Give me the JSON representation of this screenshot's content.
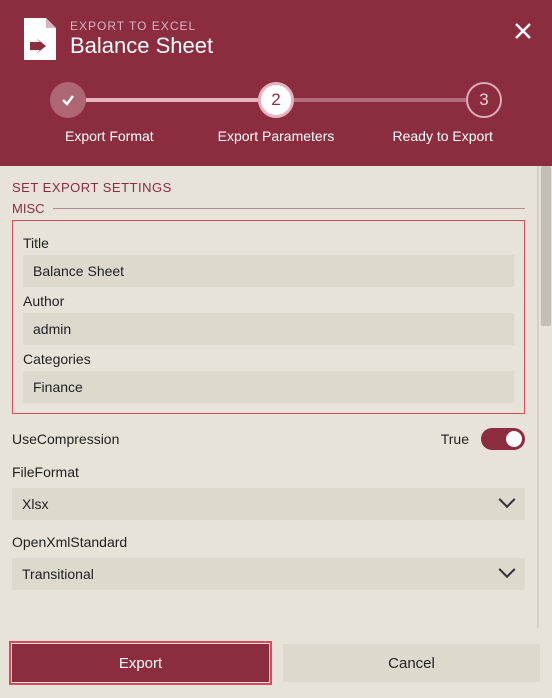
{
  "header": {
    "subtitle": "EXPORT TO EXCEL",
    "title": "Balance Sheet"
  },
  "steps": {
    "items": [
      {
        "index": 1,
        "label": "Export Format",
        "state": "done"
      },
      {
        "index": 2,
        "label": "Export Parameters",
        "state": "current"
      },
      {
        "index": 3,
        "label": "Ready to Export",
        "state": "future"
      }
    ]
  },
  "section": {
    "heading": "SET EXPORT SETTINGS",
    "group": "MISC",
    "fields": {
      "title": {
        "label": "Title",
        "value": "Balance Sheet"
      },
      "author": {
        "label": "Author",
        "value": "admin"
      },
      "categories": {
        "label": "Categories",
        "value": "Finance"
      },
      "useCompression": {
        "label": "UseCompression",
        "valueText": "True",
        "value": true
      },
      "fileFormat": {
        "label": "FileFormat",
        "value": "Xlsx",
        "options": [
          "Xlsx"
        ]
      },
      "openXmlStandard": {
        "label": "OpenXmlStandard",
        "value": "Transitional",
        "options": [
          "Transitional"
        ]
      }
    }
  },
  "footer": {
    "export": "Export",
    "cancel": "Cancel"
  },
  "colors": {
    "primary": "#8b2d3f",
    "accent": "#d94b5c",
    "surface": "#e8e3d8",
    "input": "#ded9cd"
  }
}
